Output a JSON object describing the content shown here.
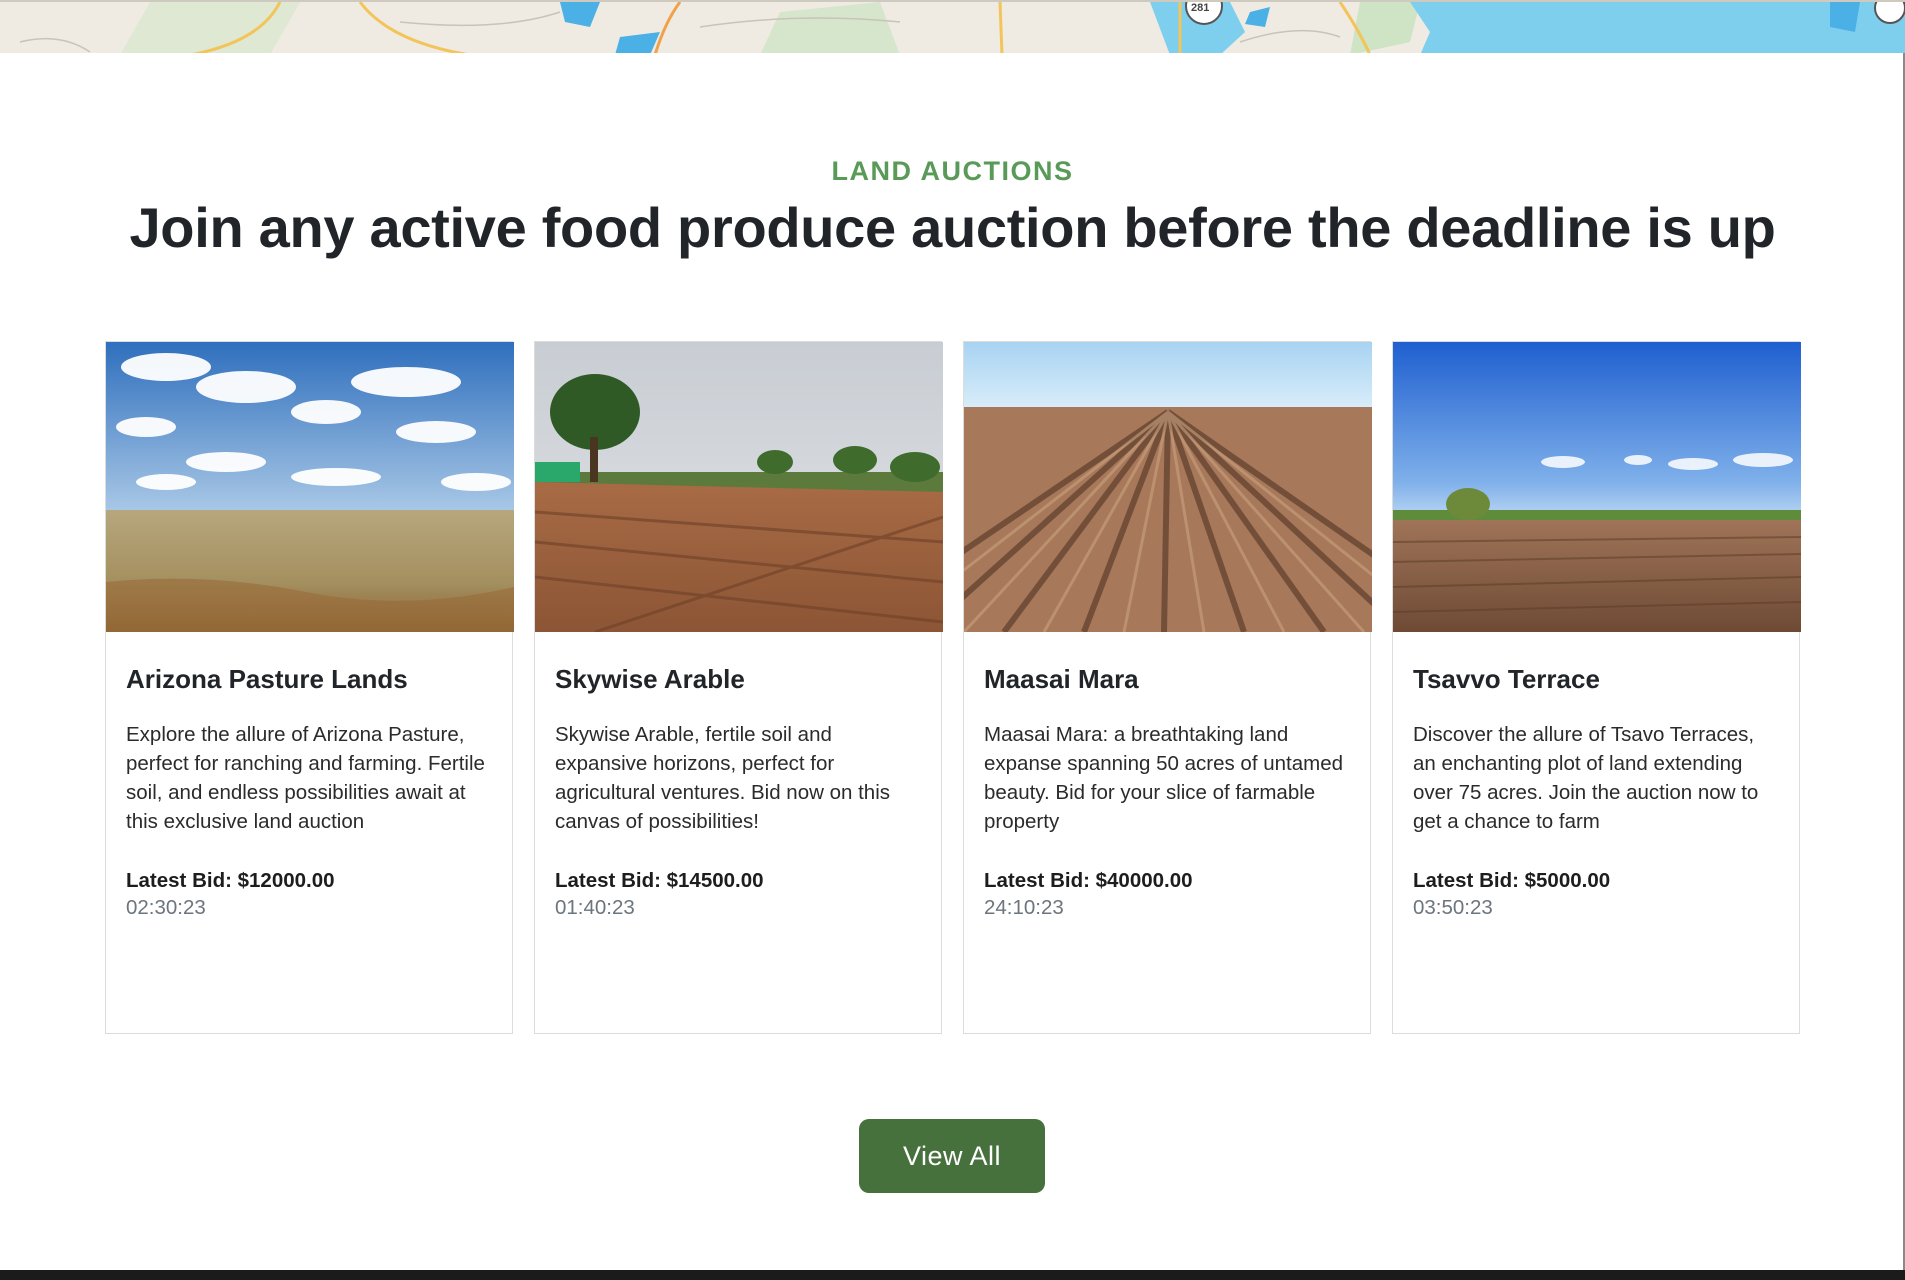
{
  "section": {
    "eyebrow": "LAND AUCTIONS",
    "headline": "Join any active food produce auction before the deadline is up"
  },
  "map_strip": {
    "road_shield_label": "281"
  },
  "cards": [
    {
      "title": "Arizona Pasture Lands",
      "description": "Explore the allure of Arizona Pasture, perfect for ranching and farming. Fertile soil, and endless possibilities await at this exclusive land auction",
      "latest_bid": "Latest Bid: $12000.00",
      "timer": "02:30:23",
      "image": "cloudy-sky-dry-pasture-photo"
    },
    {
      "title": "Skywise Arable",
      "description": "Skywise Arable, fertile soil and expansive horizons, perfect for agricultural ventures. Bid now on this canvas of possibilities!",
      "latest_bid": "Latest Bid: $14500.00",
      "timer": "01:40:23",
      "image": "tree-and-tilled-rows-photo"
    },
    {
      "title": "Maasai Mara",
      "description": "Maasai Mara: a breathtaking land expanse spanning 50 acres of untamed beauty. Bid for your slice of farmable property",
      "latest_bid": "Latest Bid: $40000.00",
      "timer": "24:10:23",
      "image": "plowed-furrows-photo"
    },
    {
      "title": "Tsavvo Terrace",
      "description": "Discover the allure of Tsavo Terraces, an enchanting plot of land extending over 75 acres. Join the auction now to get a chance to farm",
      "latest_bid": "Latest Bid: $5000.00",
      "timer": "03:50:23",
      "image": "blue-sky-bare-field-photo"
    }
  ],
  "buttons": {
    "view_all": "View All"
  },
  "colors": {
    "eyebrow_green": "#5a9a58",
    "button_green": "#46703c",
    "heading_dark": "#212529",
    "timer_gray": "#6c757d"
  }
}
